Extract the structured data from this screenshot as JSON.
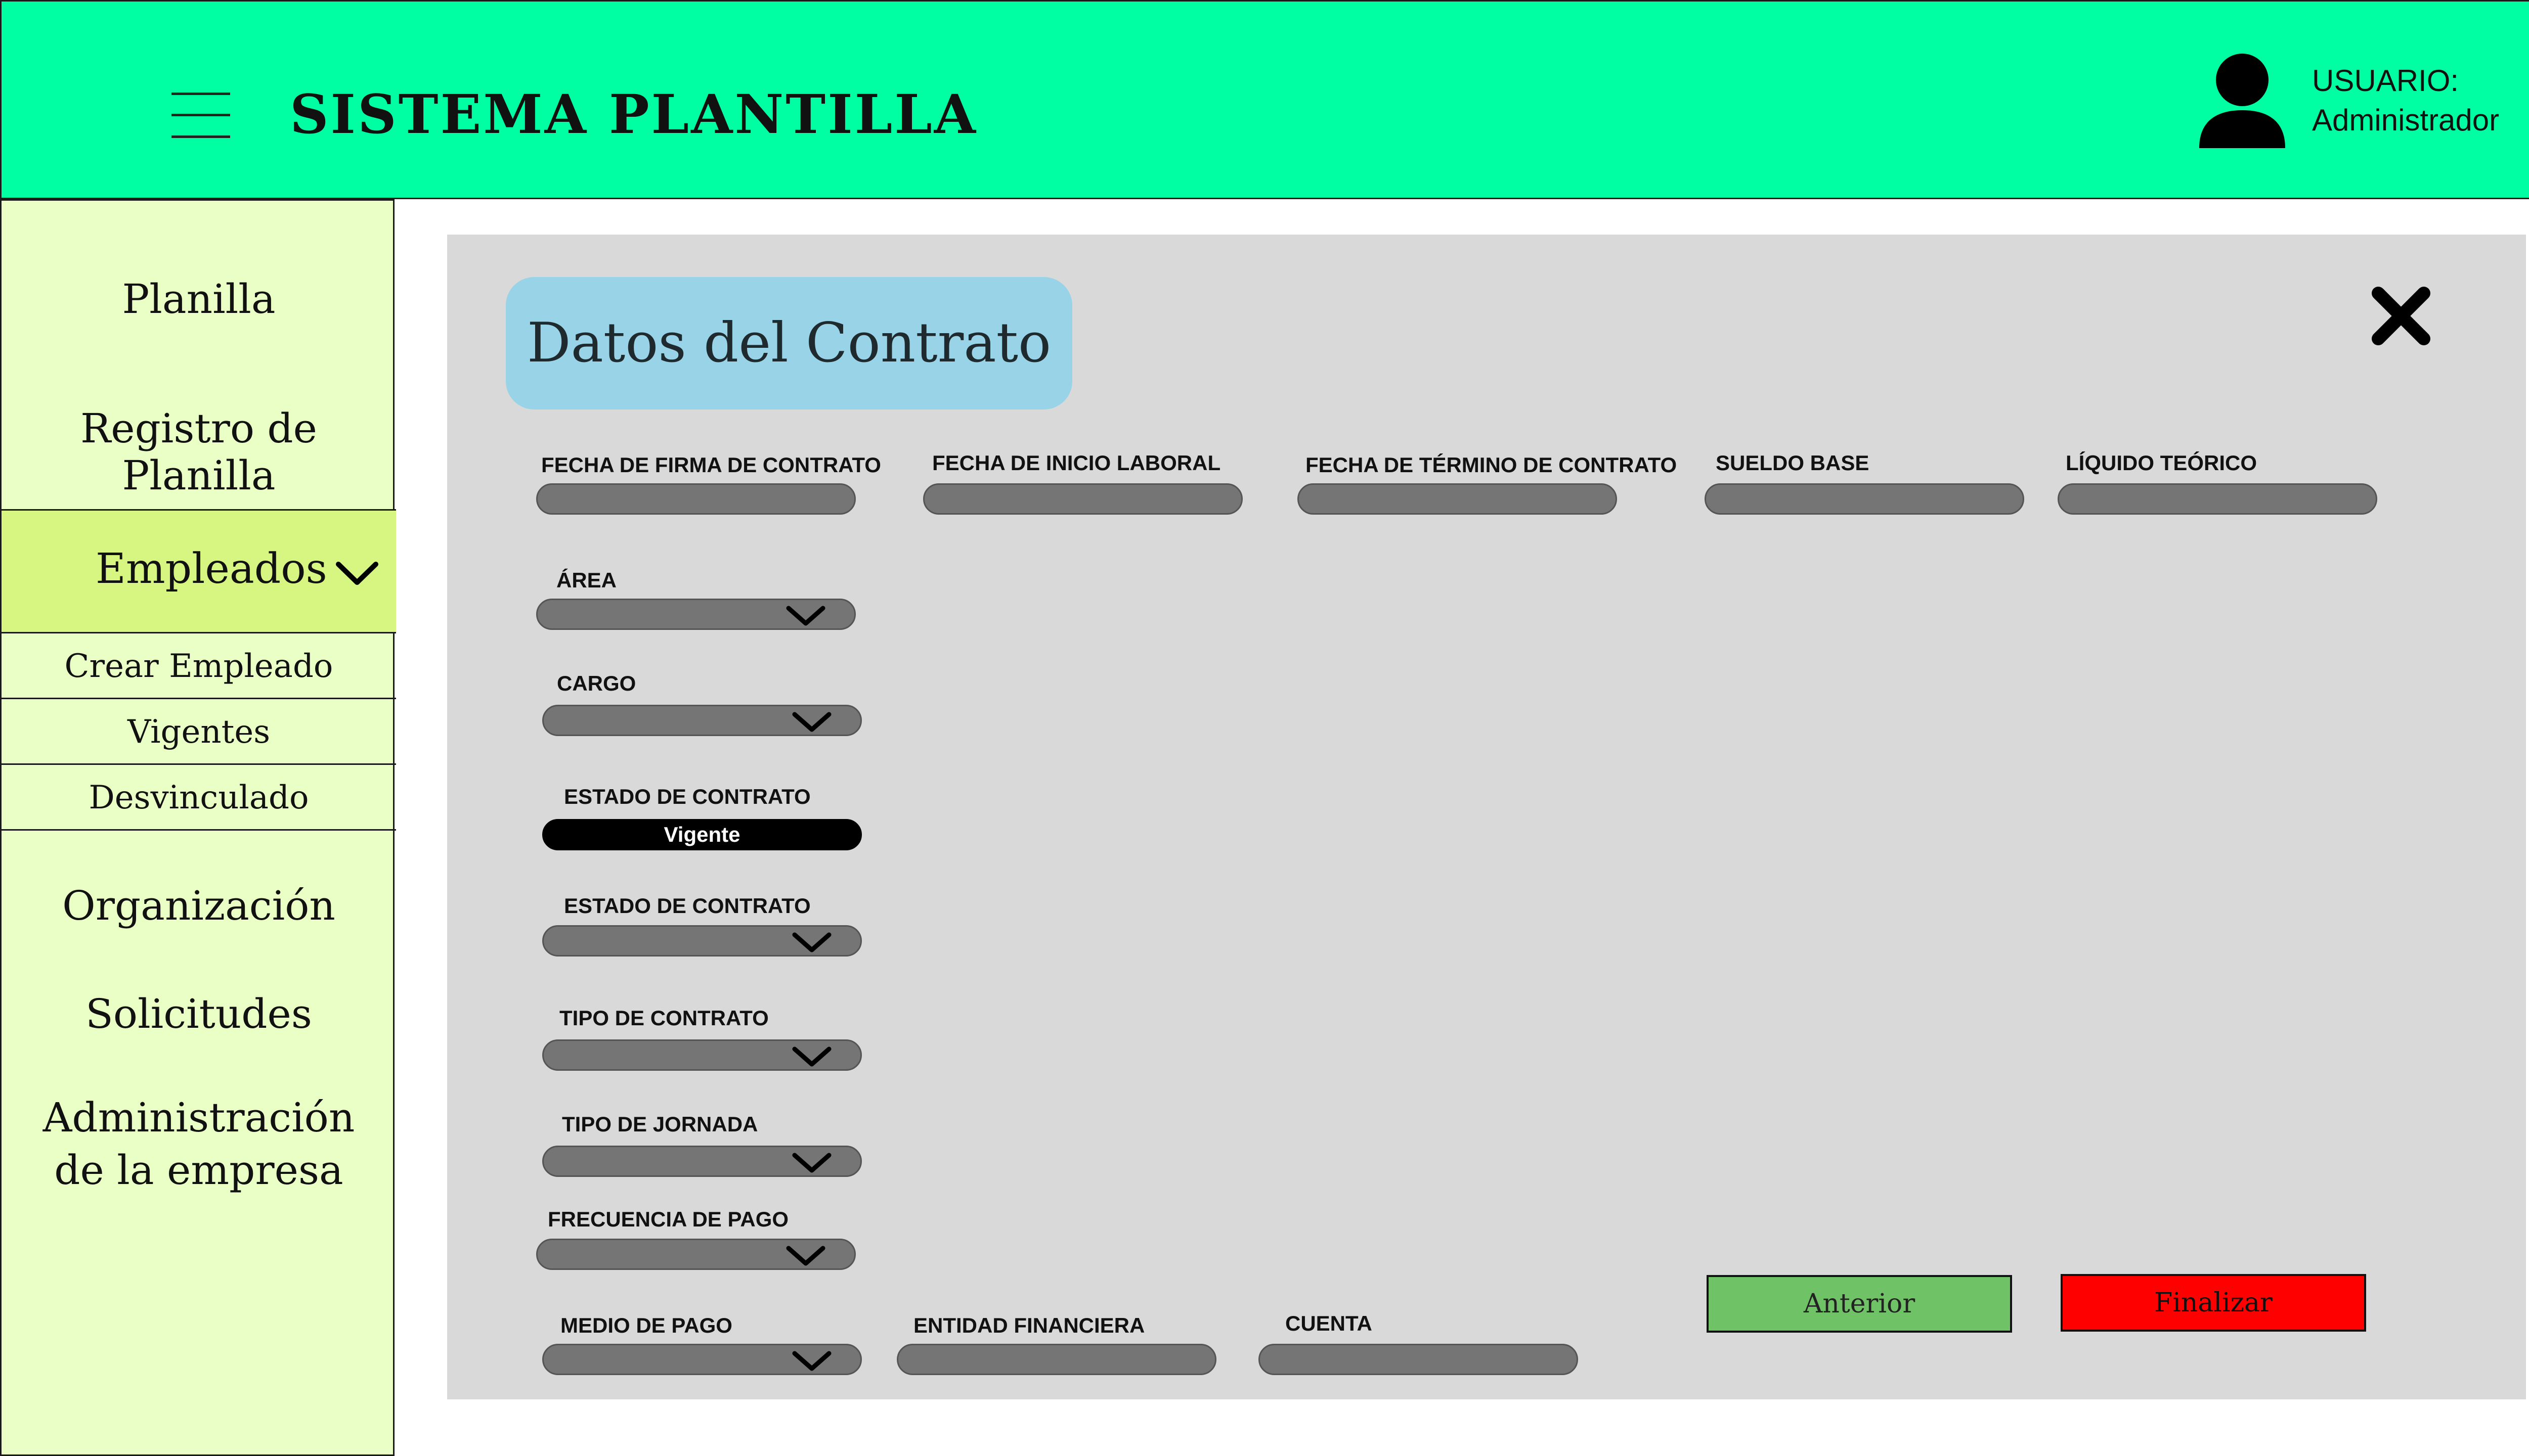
{
  "header": {
    "title": "SISTEMA PLANTILLA",
    "user_label": "USUARIO:",
    "user_name": "Administrador"
  },
  "sidebar": {
    "items": [
      {
        "label": "Planilla"
      },
      {
        "label": "Registro de Planilla"
      },
      {
        "label": "Empleados",
        "expanded": true
      },
      {
        "label": "Organización"
      },
      {
        "label": "Solicitudes"
      },
      {
        "label_line1": "Administración",
        "label_line2": "de la empresa"
      }
    ],
    "subitems": [
      {
        "label": "Crear Empleado"
      },
      {
        "label": "Vigentes"
      },
      {
        "label": "Desvinculado"
      }
    ]
  },
  "form": {
    "section_title": "Datos del Contrato",
    "fields": {
      "fecha_firma": {
        "label": "FECHA DE FIRMA DE CONTRATO",
        "value": ""
      },
      "fecha_inicio": {
        "label": "FECHA DE INICIO LABORAL",
        "value": ""
      },
      "fecha_termino": {
        "label": "FECHA DE TÉRMINO DE CONTRATO",
        "value": ""
      },
      "sueldo_base": {
        "label": "SUELDO BASE",
        "value": ""
      },
      "liquido_teorico": {
        "label": "LÍQUIDO TEÓRICO",
        "value": ""
      },
      "area": {
        "label": "ÁREA",
        "value": ""
      },
      "cargo": {
        "label": "CARGO",
        "value": ""
      },
      "estado_contrato_1": {
        "label": "ESTADO DE CONTRATO",
        "value": "Vigente"
      },
      "estado_contrato_2": {
        "label": "ESTADO DE CONTRATO",
        "value": ""
      },
      "tipo_contrato": {
        "label": "TIPO DE CONTRATO",
        "value": ""
      },
      "tipo_jornada": {
        "label": "TIPO DE JORNADA",
        "value": ""
      },
      "frecuencia_pago": {
        "label": "FRECUENCIA DE PAGO",
        "value": ""
      },
      "medio_pago": {
        "label": "MEDIO DE PAGO",
        "value": ""
      },
      "entidad_financiera": {
        "label": "ENTIDAD FINANCIERA",
        "value": ""
      },
      "cuenta": {
        "label": "CUENTA",
        "value": ""
      }
    }
  },
  "actions": {
    "previous_label": "Anterior",
    "finish_label": "Finalizar"
  },
  "colors": {
    "header_bg": "#00ffa3",
    "sidebar_bg": "#eaffc6",
    "sidebar_active_bg": "#d6f681",
    "panel_bg": "#d9d9d9",
    "title_chip_bg": "#98d3e8",
    "previous_button": "#6fc265",
    "finish_button": "#ff0000"
  }
}
